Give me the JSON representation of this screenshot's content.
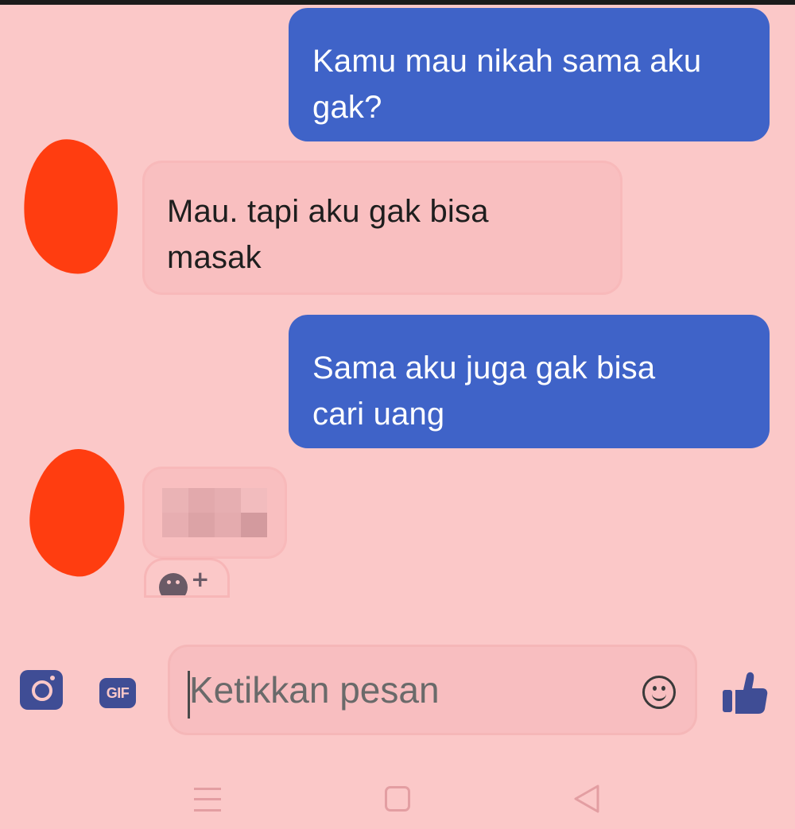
{
  "thread": {
    "messages": [
      {
        "direction": "outgoing",
        "text": "Kamu mau nikah sama aku\ngak?"
      },
      {
        "direction": "incoming",
        "text": "Mau. tapi aku gak bisa\nmasak"
      },
      {
        "direction": "outgoing",
        "text": "Sama aku juga gak bisa\ncari uang"
      },
      {
        "direction": "incoming",
        "text": ""
      }
    ]
  },
  "composer": {
    "placeholder": "Ketikkan pesan",
    "gif_label": "GIF",
    "camera_icon": "camera-icon",
    "emoji_icon": "smiley-icon",
    "like_icon": "thumbs-up-icon"
  },
  "reaction": {
    "plus_label": "+"
  },
  "colors": {
    "background": "#fbc8c8",
    "outgoing_bubble": "#3f63c8",
    "incoming_bubble": "#f9bfc0",
    "accent_icon": "#3f4d95",
    "avatar_redaction": "#ff3d10"
  }
}
